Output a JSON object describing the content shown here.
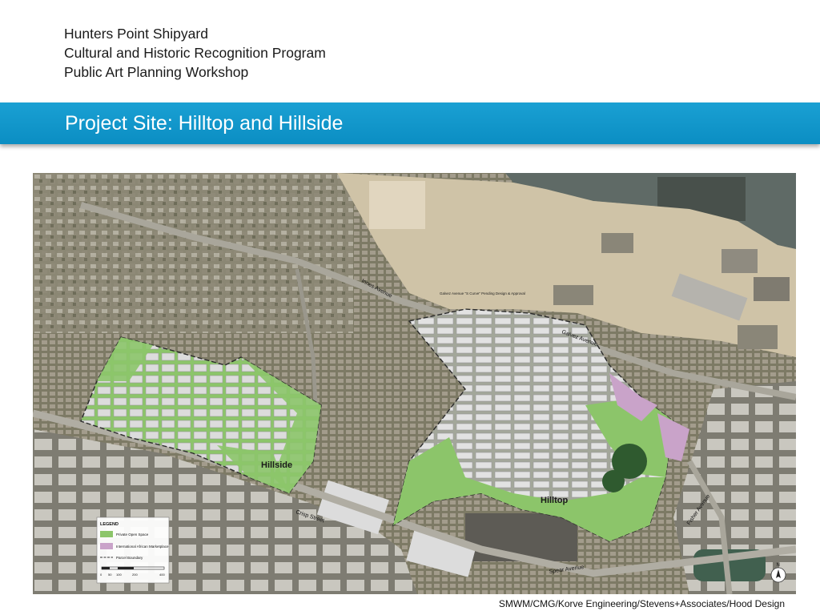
{
  "header": {
    "line1": "Hunters Point Shipyard",
    "line2": "Cultural and Historic Recognition Program",
    "line3": "Public Art Planning Workshop"
  },
  "slide": {
    "title": "Project Site: Hilltop and Hillside"
  },
  "map": {
    "areas": {
      "hillside": "Hillside",
      "hilltop": "Hilltop"
    },
    "streets": {
      "innes": "Innes Avenue",
      "galvez": "Galvez Avenue",
      "crisp": "Crisp Street",
      "spear": "Spear Avenue",
      "fisher": "Fisher Avenue"
    },
    "callout": "Galvez Avenue \"S Curve\" Pending Design & Approval",
    "legend": {
      "title": "LEGEND",
      "items": [
        {
          "label": "Private Open Space",
          "color": "#8cc56a"
        },
        {
          "label": "International African Marketplace",
          "color": "#c9a3c9"
        },
        {
          "label": "Parcel Boundary",
          "color": "#333333"
        }
      ],
      "scale": [
        "0",
        "50",
        "100",
        "200",
        "400"
      ]
    },
    "north": "N",
    "colors": {
      "water": "#5f6a66",
      "open_space": "#8cc56a",
      "marketplace": "#c9a3c9"
    }
  },
  "credit": "SMWM/CMG/Korve Engineering/Stevens+Associates/Hood Design"
}
